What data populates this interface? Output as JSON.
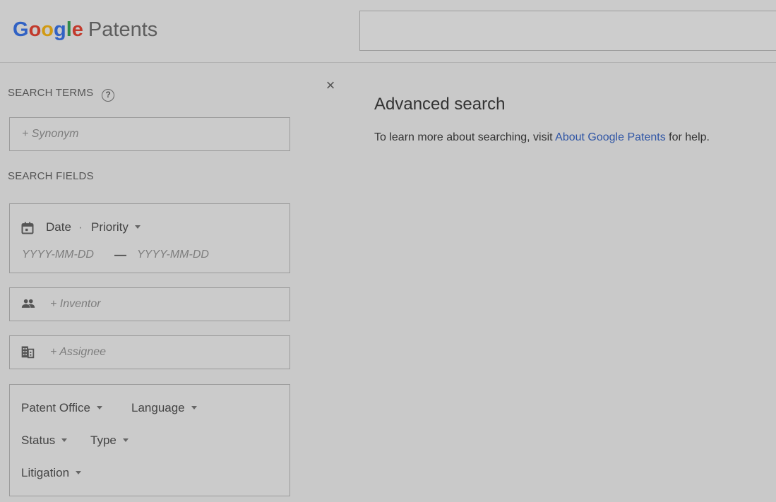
{
  "header": {
    "logo": {
      "g1": "G",
      "o1": "o",
      "o2": "o",
      "g2": "g",
      "l": "l",
      "e": "e",
      "product": "Patents"
    },
    "search_placeholder": ""
  },
  "sidebar": {
    "search_terms_label": "SEARCH TERMS",
    "help_glyph": "?",
    "synonym_placeholder": "+ Synonym",
    "search_fields_label": "SEARCH FIELDS",
    "date": {
      "label": "Date",
      "separator": "·",
      "type_label": "Priority",
      "from_placeholder": "YYYY-MM-DD",
      "dash": "—",
      "to_placeholder": "YYYY-MM-DD"
    },
    "inventor_placeholder": "+ Inventor",
    "assignee_placeholder": "+ Assignee",
    "filters": {
      "patent_office": "Patent Office",
      "language": "Language",
      "status": "Status",
      "type": "Type",
      "litigation": "Litigation"
    }
  },
  "panel": {
    "close_glyph": "×",
    "title": "Advanced search",
    "desc_prefix": "To learn more about searching, visit ",
    "desc_link": "About Google Patents",
    "desc_suffix": " for help."
  },
  "icons": {
    "calendar": "calendar-icon",
    "people": "people-icon",
    "building": "building-icon",
    "help": "help-circle-icon",
    "close": "close-icon"
  },
  "colors": {
    "background": "#c9c9c9",
    "link": "#2f55a5",
    "google_blue": "#3162c4",
    "google_red": "#c23a2c",
    "google_yellow": "#d19a14",
    "google_green": "#2f8a48"
  }
}
